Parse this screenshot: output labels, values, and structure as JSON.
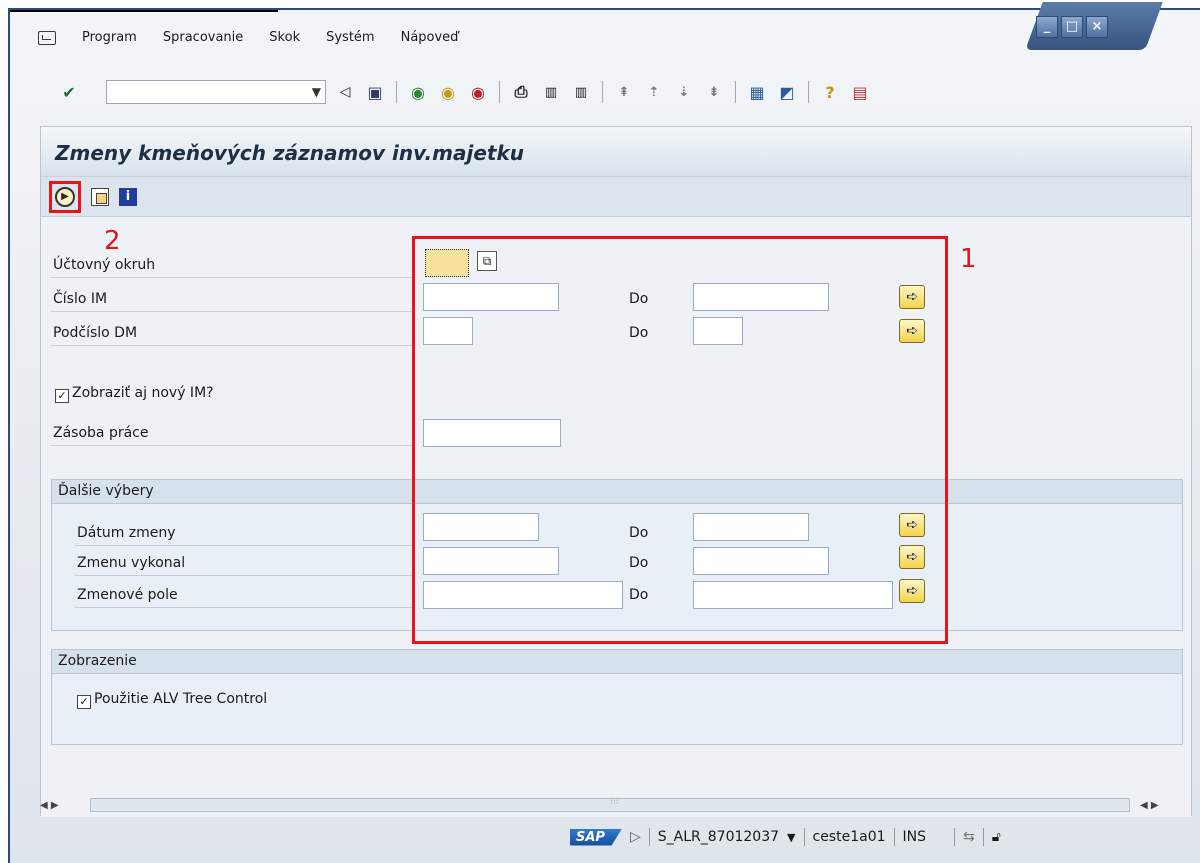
{
  "menu": {
    "items": [
      "Program",
      "Spracovanie",
      "Skok",
      "Systém",
      "Nápoveď"
    ]
  },
  "window": {
    "controls": [
      "_",
      "□",
      "×"
    ]
  },
  "toolbar": {
    "command_value": ""
  },
  "screen": {
    "title": "Zmeny kmeňových záznamov inv.majetku"
  },
  "form": {
    "company_code_label": "Účtovný okruh",
    "asset_number_label": "Číslo IM",
    "subnumber_label": "Podčíslo DM",
    "show_new_label": "Zobraziť aj nový IM?",
    "show_new_checked": true,
    "worklist_label": "Zásoba práce",
    "to_label": "Do"
  },
  "further_selections": {
    "title": "Ďalšie výbery",
    "change_date_label": "Dátum zmeny",
    "changed_by_label": "Zmenu vykonal",
    "changed_field_label": "Zmenové pole"
  },
  "display": {
    "title": "Zobrazenie",
    "alv_tree_label": "Použitie ALV Tree Control",
    "alv_tree_checked": true
  },
  "annotations": {
    "box1": "1",
    "box2": "2"
  },
  "status": {
    "logo": "SAP",
    "transaction": "S_ALR_87012037",
    "server": "ceste1a01",
    "mode": "INS"
  },
  "colors": {
    "annotation": "#e8131b",
    "window_frame": "#2b4c76",
    "required_field": "#f6e29b"
  }
}
